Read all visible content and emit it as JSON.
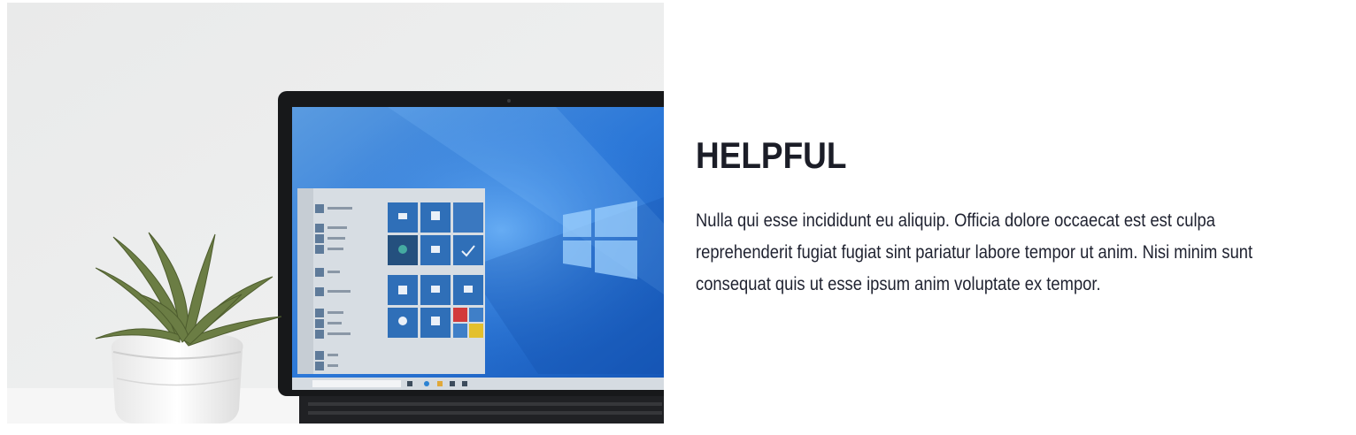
{
  "feature": {
    "image": {
      "icon": "laptop-photo",
      "description_alt": "Laptop with start menu next to a succulent plant"
    },
    "title": "HELPFUL",
    "body": "Nulla qui esse incididunt eu aliquip. Officia dolore occaecat est est culpa reprehenderit fugiat fugiat sint pariatur labore tempor ut anim. Nisi minim sunt consequat quis ut esse ipsum anim voluptate ex tempor."
  },
  "colors": {
    "title": "#1b1d27",
    "body": "#1f2230",
    "screen_blue": "#1f6fd6",
    "wall": "#eceded"
  }
}
